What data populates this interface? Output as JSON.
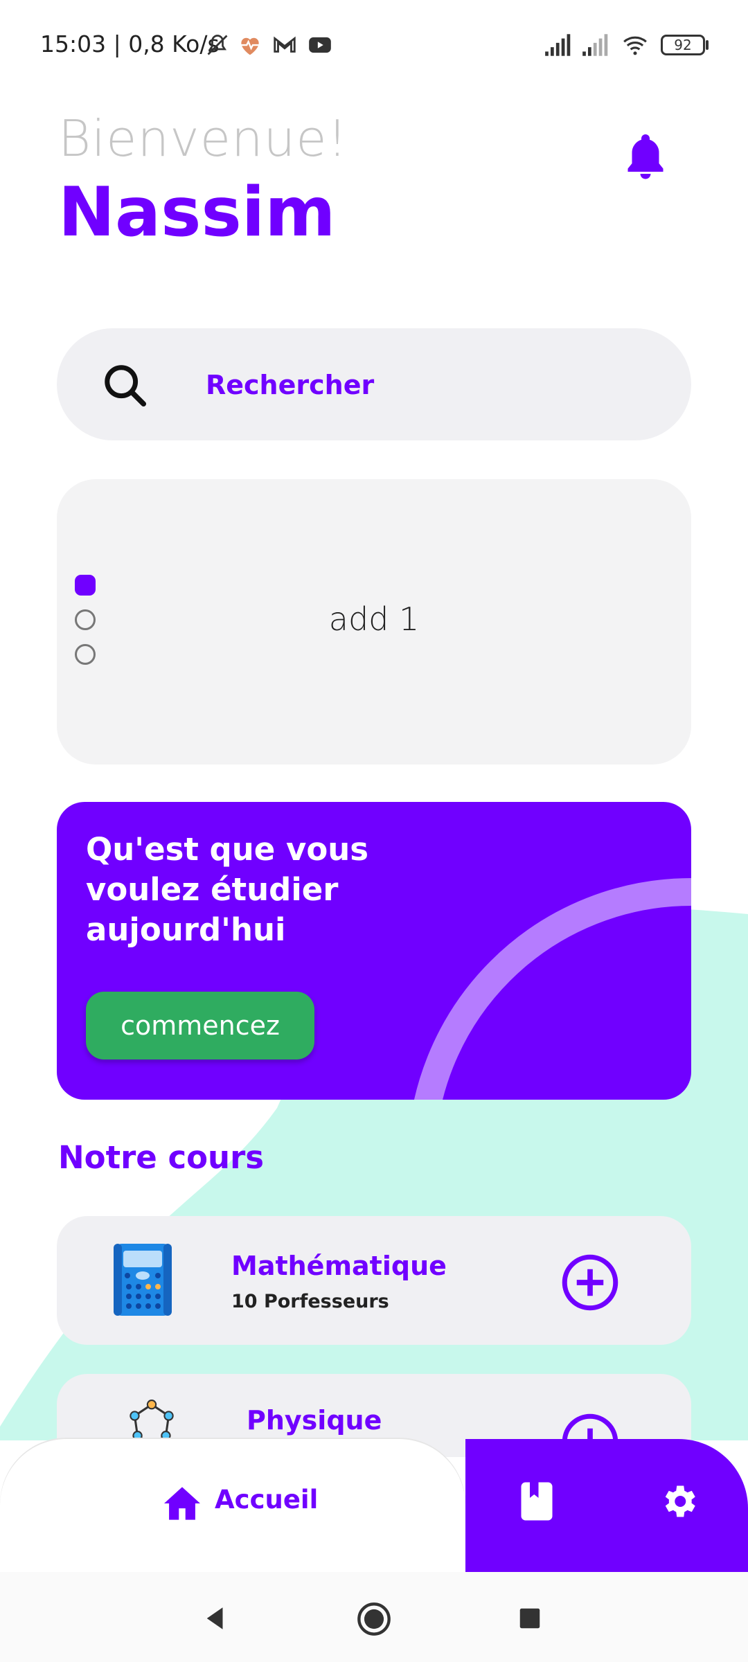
{
  "status_bar": {
    "time_speed": "15:03 | 0,8 Ko/s",
    "battery": "92",
    "icons": [
      "bell-off-icon",
      "health-heart-icon",
      "gmail-icon",
      "youtube-icon",
      "signal-icon",
      "signal-icon",
      "wifi-icon",
      "battery-icon"
    ]
  },
  "header": {
    "greeting": "Bienvenue!",
    "user_name": "Nassim",
    "notification_icon": "bell-icon"
  },
  "search": {
    "label": "Rechercher",
    "icon": "search-icon"
  },
  "carousel": {
    "text": "add 1",
    "active_index": 0,
    "count": 3
  },
  "promo": {
    "headline": "Qu'est que vous voulez étudier aujourd'hui",
    "button_label": "commencez"
  },
  "section_title": "Notre cours",
  "courses": [
    {
      "title": "Mathématique",
      "subtitle": "10 Porfesseurs",
      "icon": "calculator-icon"
    },
    {
      "title": "Physique",
      "subtitle": "",
      "icon": "molecule-icon"
    }
  ],
  "bottom_nav": {
    "home_label": "Accueil",
    "items": [
      "home-icon",
      "book-icon",
      "gear-icon"
    ]
  },
  "colors": {
    "primary": "#7000ff",
    "accent_green": "#2fac60",
    "teal": "#c8f8ec",
    "card_bg": "#f0f0f3"
  }
}
